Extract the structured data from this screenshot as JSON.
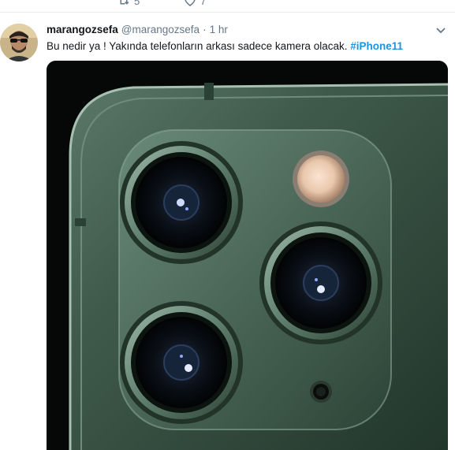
{
  "prev_tweet": {
    "retweet_count": "5",
    "like_count": "7"
  },
  "tweet": {
    "author_name": "marangozsefa",
    "author_handle": "@marangozsefa",
    "separator": "·",
    "timestamp": "1 hr",
    "text": "Bu nedir ya ! Yakında telefonların arkası sadece kamera olacak.",
    "hashtag": "#iPhone11"
  },
  "icons": {
    "retweet": "retweet-icon",
    "like": "heart-icon",
    "menu": "chevron-down-icon"
  },
  "colors": {
    "link": "#1b95e0",
    "muted": "#657786",
    "text": "#14171a",
    "phone_green": "#3f5a4b"
  }
}
